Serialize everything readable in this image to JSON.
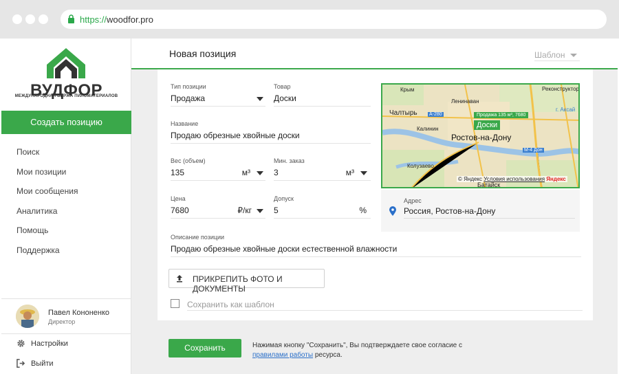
{
  "browser": {
    "url_protocol": "https://",
    "url_host": "woodfor.pro"
  },
  "brand": {
    "name": "ВУДФОР",
    "tagline": "МЕЖДУНАРОДНАЯ БИРЖА ПИЛОМАТЕРИАЛОВ",
    "accent_color": "#3aa84a"
  },
  "sidebar": {
    "create_label": "Создать позицию",
    "items": [
      {
        "label": "Поиск"
      },
      {
        "label": "Мои позиции"
      },
      {
        "label": "Мои сообщения"
      },
      {
        "label": "Аналитика"
      },
      {
        "label": "Помощь"
      },
      {
        "label": "Поддержка"
      }
    ],
    "user": {
      "name": "Павел Кононенко",
      "role": "Директор"
    },
    "settings_label": "Настройки",
    "logout_label": "Выйти"
  },
  "header": {
    "title": "Новая позиция",
    "template_select": "Шаблон"
  },
  "form": {
    "type": {
      "label": "Тип позиции",
      "value": "Продажа"
    },
    "product": {
      "label": "Товар",
      "value": "Доски"
    },
    "name": {
      "label": "Название",
      "value": "Продаю обрезные хвойные доски"
    },
    "weight": {
      "label": "Вес (объем)",
      "value": "135",
      "unit": "м³"
    },
    "min_order": {
      "label": "Мин. заказ",
      "value": "3",
      "unit": "м³"
    },
    "price": {
      "label": "Цена",
      "value": "7680",
      "unit": "₽/кг"
    },
    "tolerance": {
      "label": "Допуск",
      "value": "5",
      "unit": "%"
    },
    "description": {
      "label": "Описание позиции",
      "value": "Продаю обрезные хвойные доски естественной влажности"
    },
    "attach_label": "ПРИКРЕПИТЬ ФОТО И ДОКУМЕНТЫ",
    "save_template_label": "Сохранить как шаблон"
  },
  "map": {
    "labels": {
      "krym": "Крым",
      "leninavan": "Ленинаван",
      "rekonstruktor": "Реконструктор",
      "chaltyr": "Чалтырь",
      "kalinin": "Калинин",
      "kolyzaevo": "Колузаево",
      "bataysk": "Батайск",
      "aksay": "г. Аксай",
      "city": "Ростов-на-Дону",
      "road_a280": "А-280",
      "road_m4": "М-4 Дон"
    },
    "pin_badge": "Продажа 135 м³, 7680",
    "pin_title": "Доски",
    "copyright": "© Яндекс",
    "terms": "Условия использования",
    "provider": "Яндекс"
  },
  "address": {
    "label": "Адрес",
    "value": "Россия, Ростов-на-Дону"
  },
  "footer": {
    "save_label": "Сохранить",
    "consent_before": "Нажимая кнопку \"Сохранить\", Вы подтверждаете свое согласие с",
    "consent_link": "правилами работы",
    "consent_after": " ресурса."
  }
}
